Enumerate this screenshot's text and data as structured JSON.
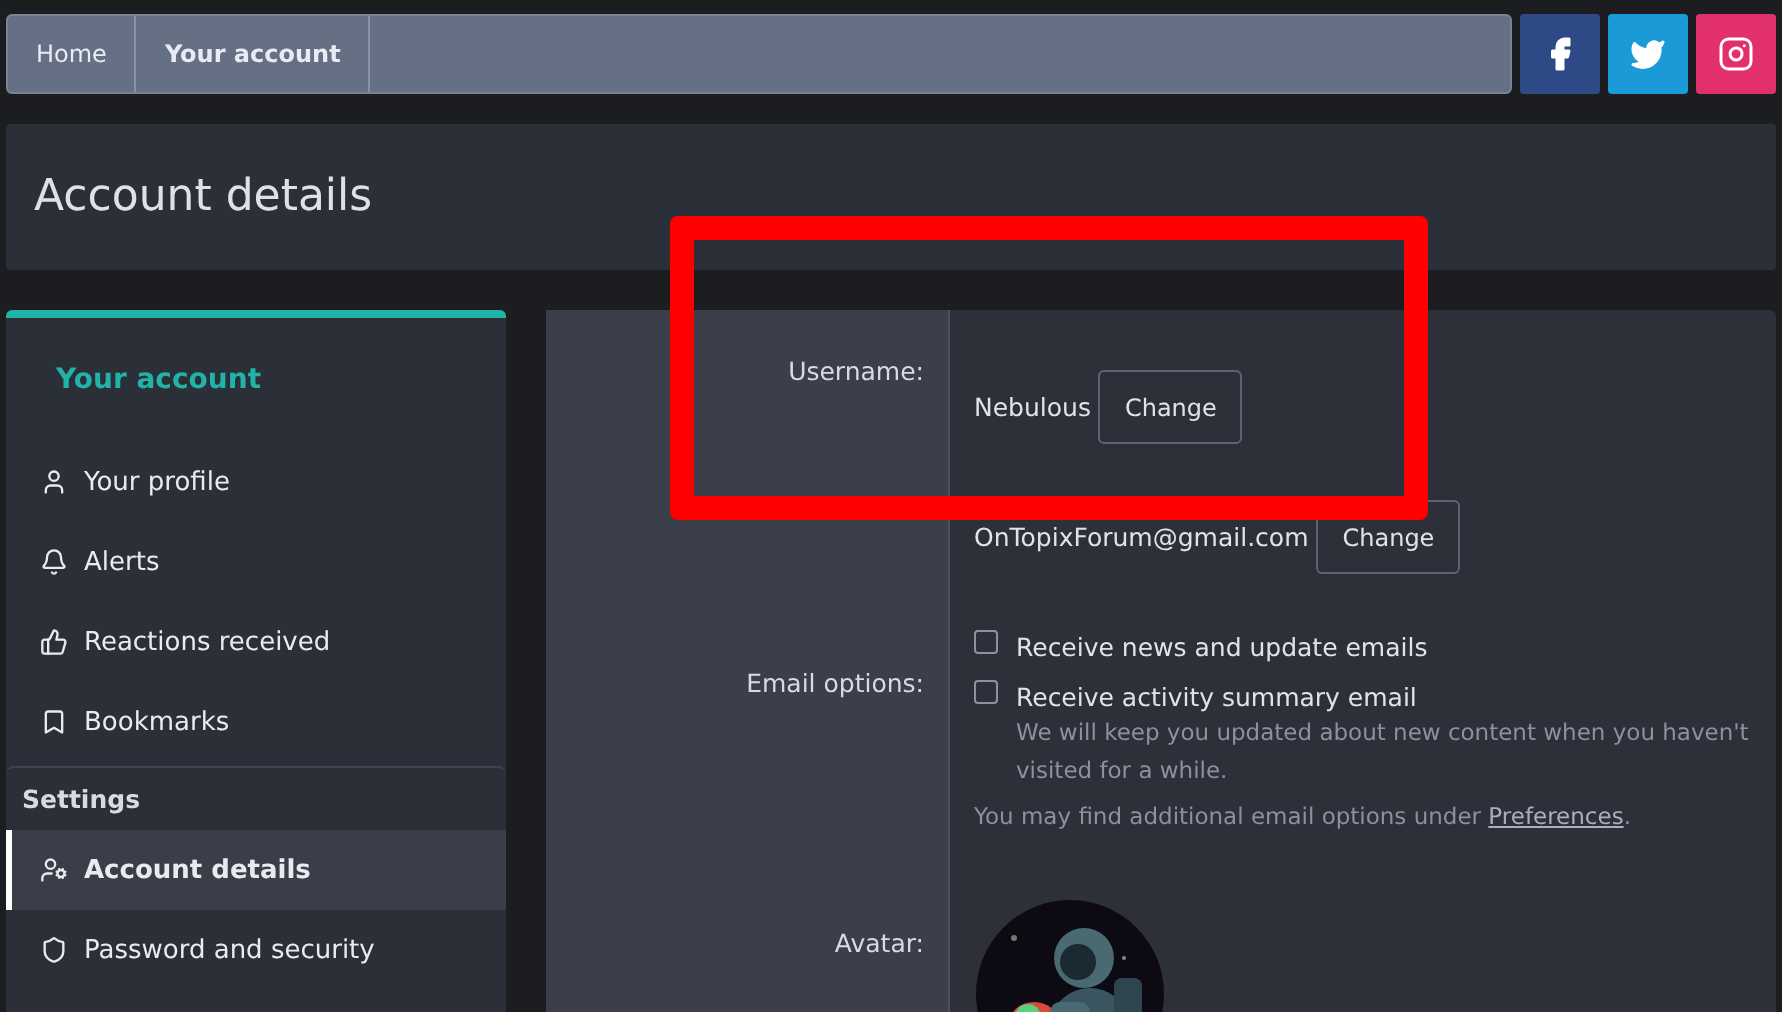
{
  "breadcrumb": [
    {
      "label": "Home",
      "current": false
    },
    {
      "label": "Your account",
      "current": true
    }
  ],
  "social": [
    {
      "kind": "facebook",
      "color": "#2e4a86"
    },
    {
      "kind": "twitter",
      "color": "#1a9bd7"
    },
    {
      "kind": "instagram",
      "color": "#e1306c"
    }
  ],
  "page_title": "Account details",
  "sidebar": {
    "title": "Your account",
    "items": [
      {
        "label": "Your profile",
        "selected": false
      },
      {
        "label": "Alerts",
        "selected": false
      },
      {
        "label": "Reactions received",
        "selected": false
      },
      {
        "label": "Bookmarks",
        "selected": false
      }
    ],
    "section": "Settings",
    "settings_items": [
      {
        "label": "Account details",
        "selected": true
      },
      {
        "label": "Password and security",
        "selected": false
      }
    ]
  },
  "form": {
    "username": {
      "label": "Username:",
      "value": "Nebulous",
      "button": "Change"
    },
    "email": {
      "value": "OnTopixForum@gmail.com",
      "button": "Change"
    },
    "email_options": {
      "label": "Email options:",
      "options": [
        {
          "label": "Receive news and update emails",
          "checked": false
        },
        {
          "label": "Receive activity summary email",
          "checked": false,
          "hint": "We will keep you updated about new content when you haven't visited for a while."
        }
      ],
      "note": "You may find additional email options under ",
      "link": "Preferences",
      "note_end": "."
    },
    "avatar": {
      "label": "Avatar:",
      "kind": "picture"
    }
  }
}
